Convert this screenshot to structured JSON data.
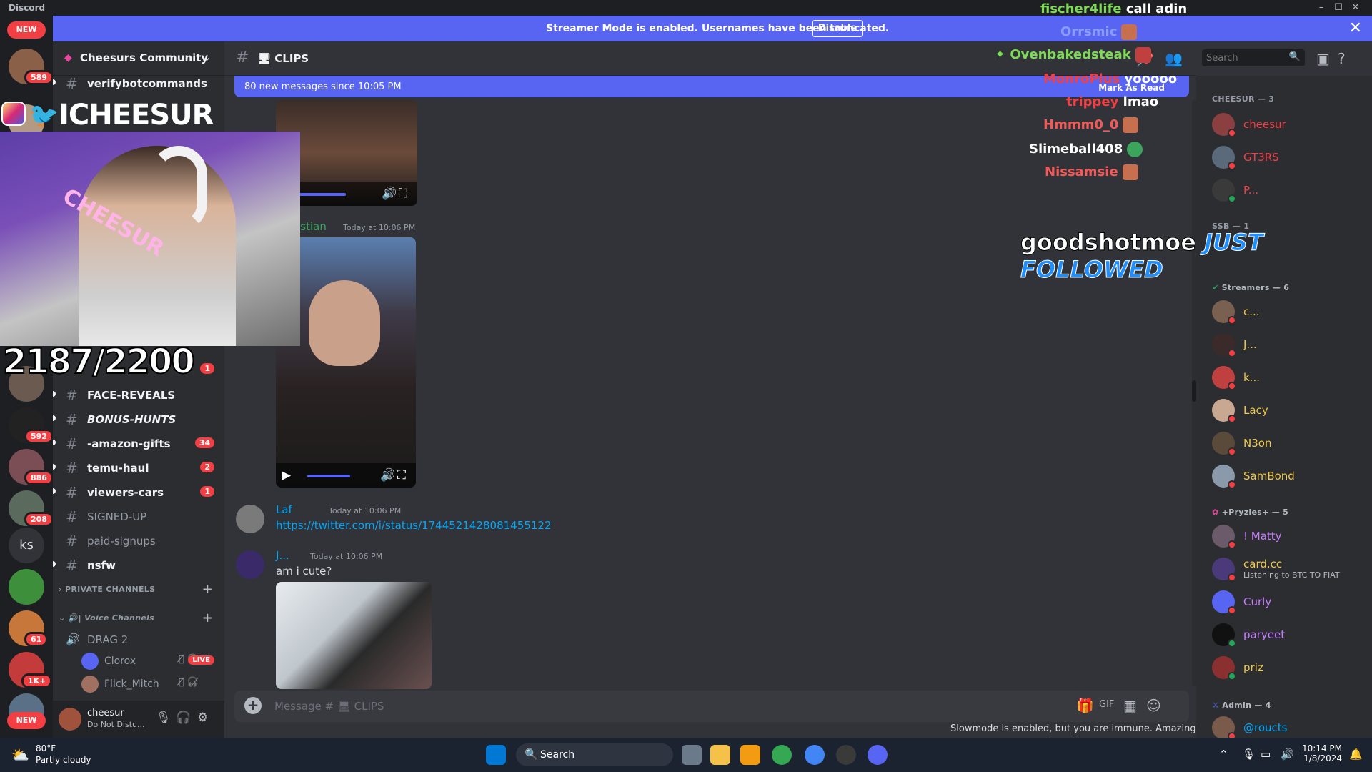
{
  "window": {
    "app_name": "Discord",
    "minimize": "–",
    "maximize": "☐",
    "close": "✕"
  },
  "banner": {
    "text": "Streamer Mode is enabled. Usernames have been truncated.",
    "disable_label": "Disable",
    "close": "✕"
  },
  "rail": {
    "new_top": "NEW",
    "new_bottom": "NEW",
    "badges": [
      "589",
      "592",
      "886",
      "208",
      "61",
      "1K+"
    ],
    "ks_label": "ks"
  },
  "server": {
    "name": "Cheesurs Community",
    "chevron": "⌄"
  },
  "channels": [
    {
      "name": "verifybotcommands",
      "badge": ""
    },
    {
      "name": "FACE-REVEALS",
      "badge": "1"
    },
    {
      "name": "BONUS-HUNTS",
      "badge": ""
    },
    {
      "name": "-amazon-gifts",
      "badge": "34"
    },
    {
      "name": "temu-haul",
      "badge": "2"
    },
    {
      "name": "viewers-cars",
      "badge": "1"
    },
    {
      "name": "SIGNED-UP",
      "badge": ""
    },
    {
      "name": "paid-signups",
      "badge": ""
    },
    {
      "name": "nsfw",
      "badge": ""
    }
  ],
  "categories": {
    "private": "PRIVATE CHANNELS",
    "voice": "| Voice Channels"
  },
  "voice": {
    "channel": "DRAG 2",
    "users": [
      {
        "name": "Clorox",
        "live": "LIVE"
      },
      {
        "name": "Flick_Mitch",
        "live": ""
      }
    ]
  },
  "user_panel": {
    "name": "cheesur",
    "status": "Do Not Distu..."
  },
  "chat": {
    "channel_name": "CLIPS",
    "search_placeholder": "Search",
    "new_messages": "80 new messages since 10:05 PM",
    "mark_as_read": "Mark As Read",
    "messages": [
      {
        "author": "...stian",
        "time": "Today at 10:06 PM"
      },
      {
        "author": "Laf",
        "time": "Today at 10:06 PM",
        "link": "https://twitter.com/i/status/1744521428081455122"
      },
      {
        "author": "J...",
        "time": "Today at 10:06 PM",
        "body": "am i cute?"
      }
    ],
    "composer_placeholder": "Message # 🖥 CLIPS",
    "slowmode": "Slowmode is enabled, but you are immune. Amazing!"
  },
  "members": {
    "groups": [
      {
        "title": "CHEESUR — 3",
        "members": [
          {
            "name": "cheesur",
            "color": "#f23f43",
            "status": "dnd",
            "sub": ""
          },
          {
            "name": "GT3RS",
            "color": "#f23f43",
            "status": "dnd",
            "sub": ""
          },
          {
            "name": "P...",
            "color": "#f23f43",
            "status": "online",
            "sub": ""
          }
        ]
      },
      {
        "title": "SSB — 1",
        "members": []
      },
      {
        "title": "Streamers — 6",
        "members": [
          {
            "name": "c...",
            "color": "#f0c94a",
            "status": "dnd",
            "sub": ""
          },
          {
            "name": "J...",
            "color": "#f0c94a",
            "status": "dnd",
            "sub": ""
          },
          {
            "name": "k...",
            "color": "#f0c94a",
            "status": "dnd",
            "sub": ""
          },
          {
            "name": "Lacy",
            "color": "#f0c94a",
            "status": "dnd",
            "sub": ""
          },
          {
            "name": "N3on",
            "color": "#f0c94a",
            "status": "dnd",
            "sub": ""
          },
          {
            "name": "SamBond",
            "color": "#f0c94a",
            "status": "dnd",
            "sub": ""
          }
        ]
      },
      {
        "title": "+Pryzles+ — 5",
        "members": [
          {
            "name": "! Matty",
            "color": "#c77dff",
            "status": "dnd",
            "sub": ""
          },
          {
            "name": "card.cc",
            "color": "#f0c94a",
            "status": "dnd",
            "sub": "Listening to BTC TO FIAT"
          },
          {
            "name": "Curly",
            "color": "#c77dff",
            "status": "dnd",
            "sub": ""
          },
          {
            "name": "paryeet",
            "color": "#c77dff",
            "status": "online",
            "sub": ""
          },
          {
            "name": "priz",
            "color": "#f0c94a",
            "status": "online",
            "sub": ""
          }
        ]
      },
      {
        "title": "Admin — 4",
        "members": [
          {
            "name": "@roucts",
            "color": "#00a8fc",
            "status": "dnd",
            "sub": ""
          }
        ]
      }
    ]
  },
  "overlay": {
    "handle": "ICHEESUR",
    "sub_count": "2187/2200",
    "top_names": [
      "fischer4life",
      "call adin"
    ],
    "chat": [
      {
        "user": "Orrsmic",
        "text": ""
      },
      {
        "user": "Ovenbakedsteak",
        "text": ""
      },
      {
        "user": "MonroPlus",
        "text": "yooooo"
      },
      {
        "user": "trippey",
        "text": "lmao"
      },
      {
        "user": "Hmmm0_0",
        "text": ""
      },
      {
        "user": "Slimeball408",
        "text": ""
      },
      {
        "user": "Nissamsie",
        "text": ""
      }
    ],
    "follow_user": "goodshotmoe",
    "follow_text": "JUST FOLLOWED",
    "neon": "CHEESUR"
  },
  "taskbar": {
    "temp": "80°F",
    "weather": "Partly cloudy",
    "search_placeholder": "Search",
    "time": "10:14 PM",
    "date": "1/8/2024"
  }
}
